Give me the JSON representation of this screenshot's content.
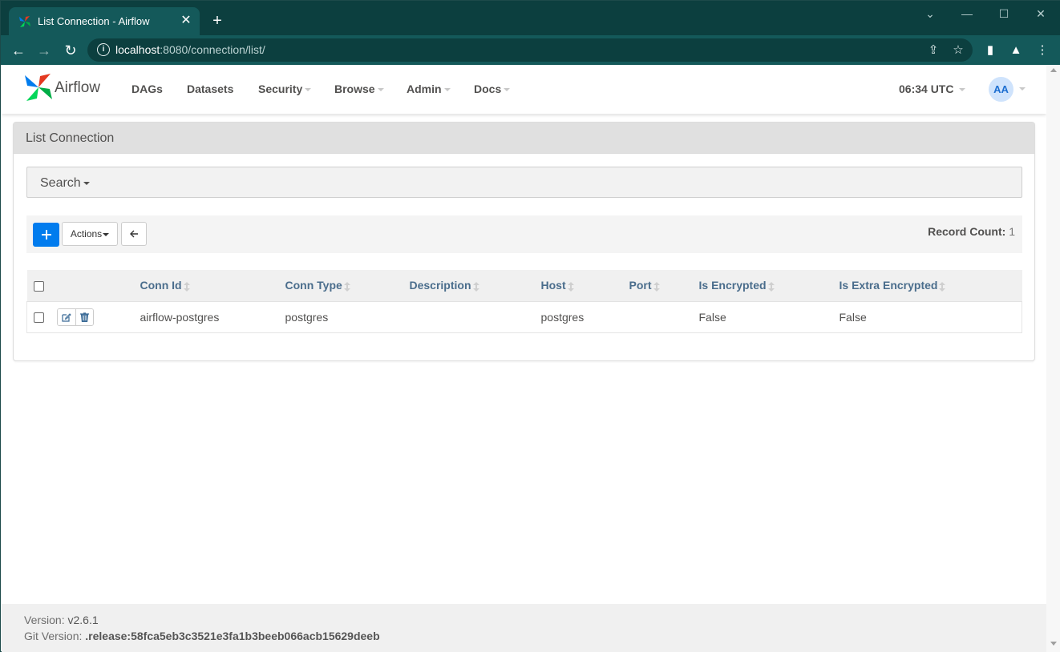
{
  "browser": {
    "tab_title": "List Connection - Airflow",
    "tab_close": "✕",
    "new_tab": "+",
    "url_host": "localhost",
    "url_path": ":8080/connection/list/"
  },
  "navbar": {
    "brand": "Airflow",
    "menu": [
      {
        "label": "DAGs",
        "dropdown": false
      },
      {
        "label": "Datasets",
        "dropdown": false
      },
      {
        "label": "Security",
        "dropdown": true
      },
      {
        "label": "Browse",
        "dropdown": true
      },
      {
        "label": "Admin",
        "dropdown": true
      },
      {
        "label": "Docs",
        "dropdown": true
      }
    ],
    "clock": "06:34 UTC",
    "avatar_initials": "AA"
  },
  "panel": {
    "title": "List Connection",
    "search_label": "Search",
    "actions_label": "Actions",
    "record_count_label": "Record Count:",
    "record_count_value": "1"
  },
  "table": {
    "columns": [
      "Conn Id",
      "Conn Type",
      "Description",
      "Host",
      "Port",
      "Is Encrypted",
      "Is Extra Encrypted"
    ],
    "rows": [
      {
        "conn_id": "airflow-postgres",
        "conn_type": "postgres",
        "description": "",
        "host": "postgres",
        "port": "",
        "is_encrypted": "False",
        "is_extra_encrypted": "False"
      }
    ]
  },
  "footer": {
    "version_label": "Version:",
    "version_value": "v2.6.1",
    "git_label": "Git Version:",
    "git_value": ".release:58fca5eb3c3521e3fa1b3beeb066acb15629deeb"
  },
  "colors": {
    "chrome_dark": "#0c3f3f",
    "chrome_tab": "#14595a",
    "accent_blue": "#017cee",
    "header_text": "#4a6d8c"
  }
}
